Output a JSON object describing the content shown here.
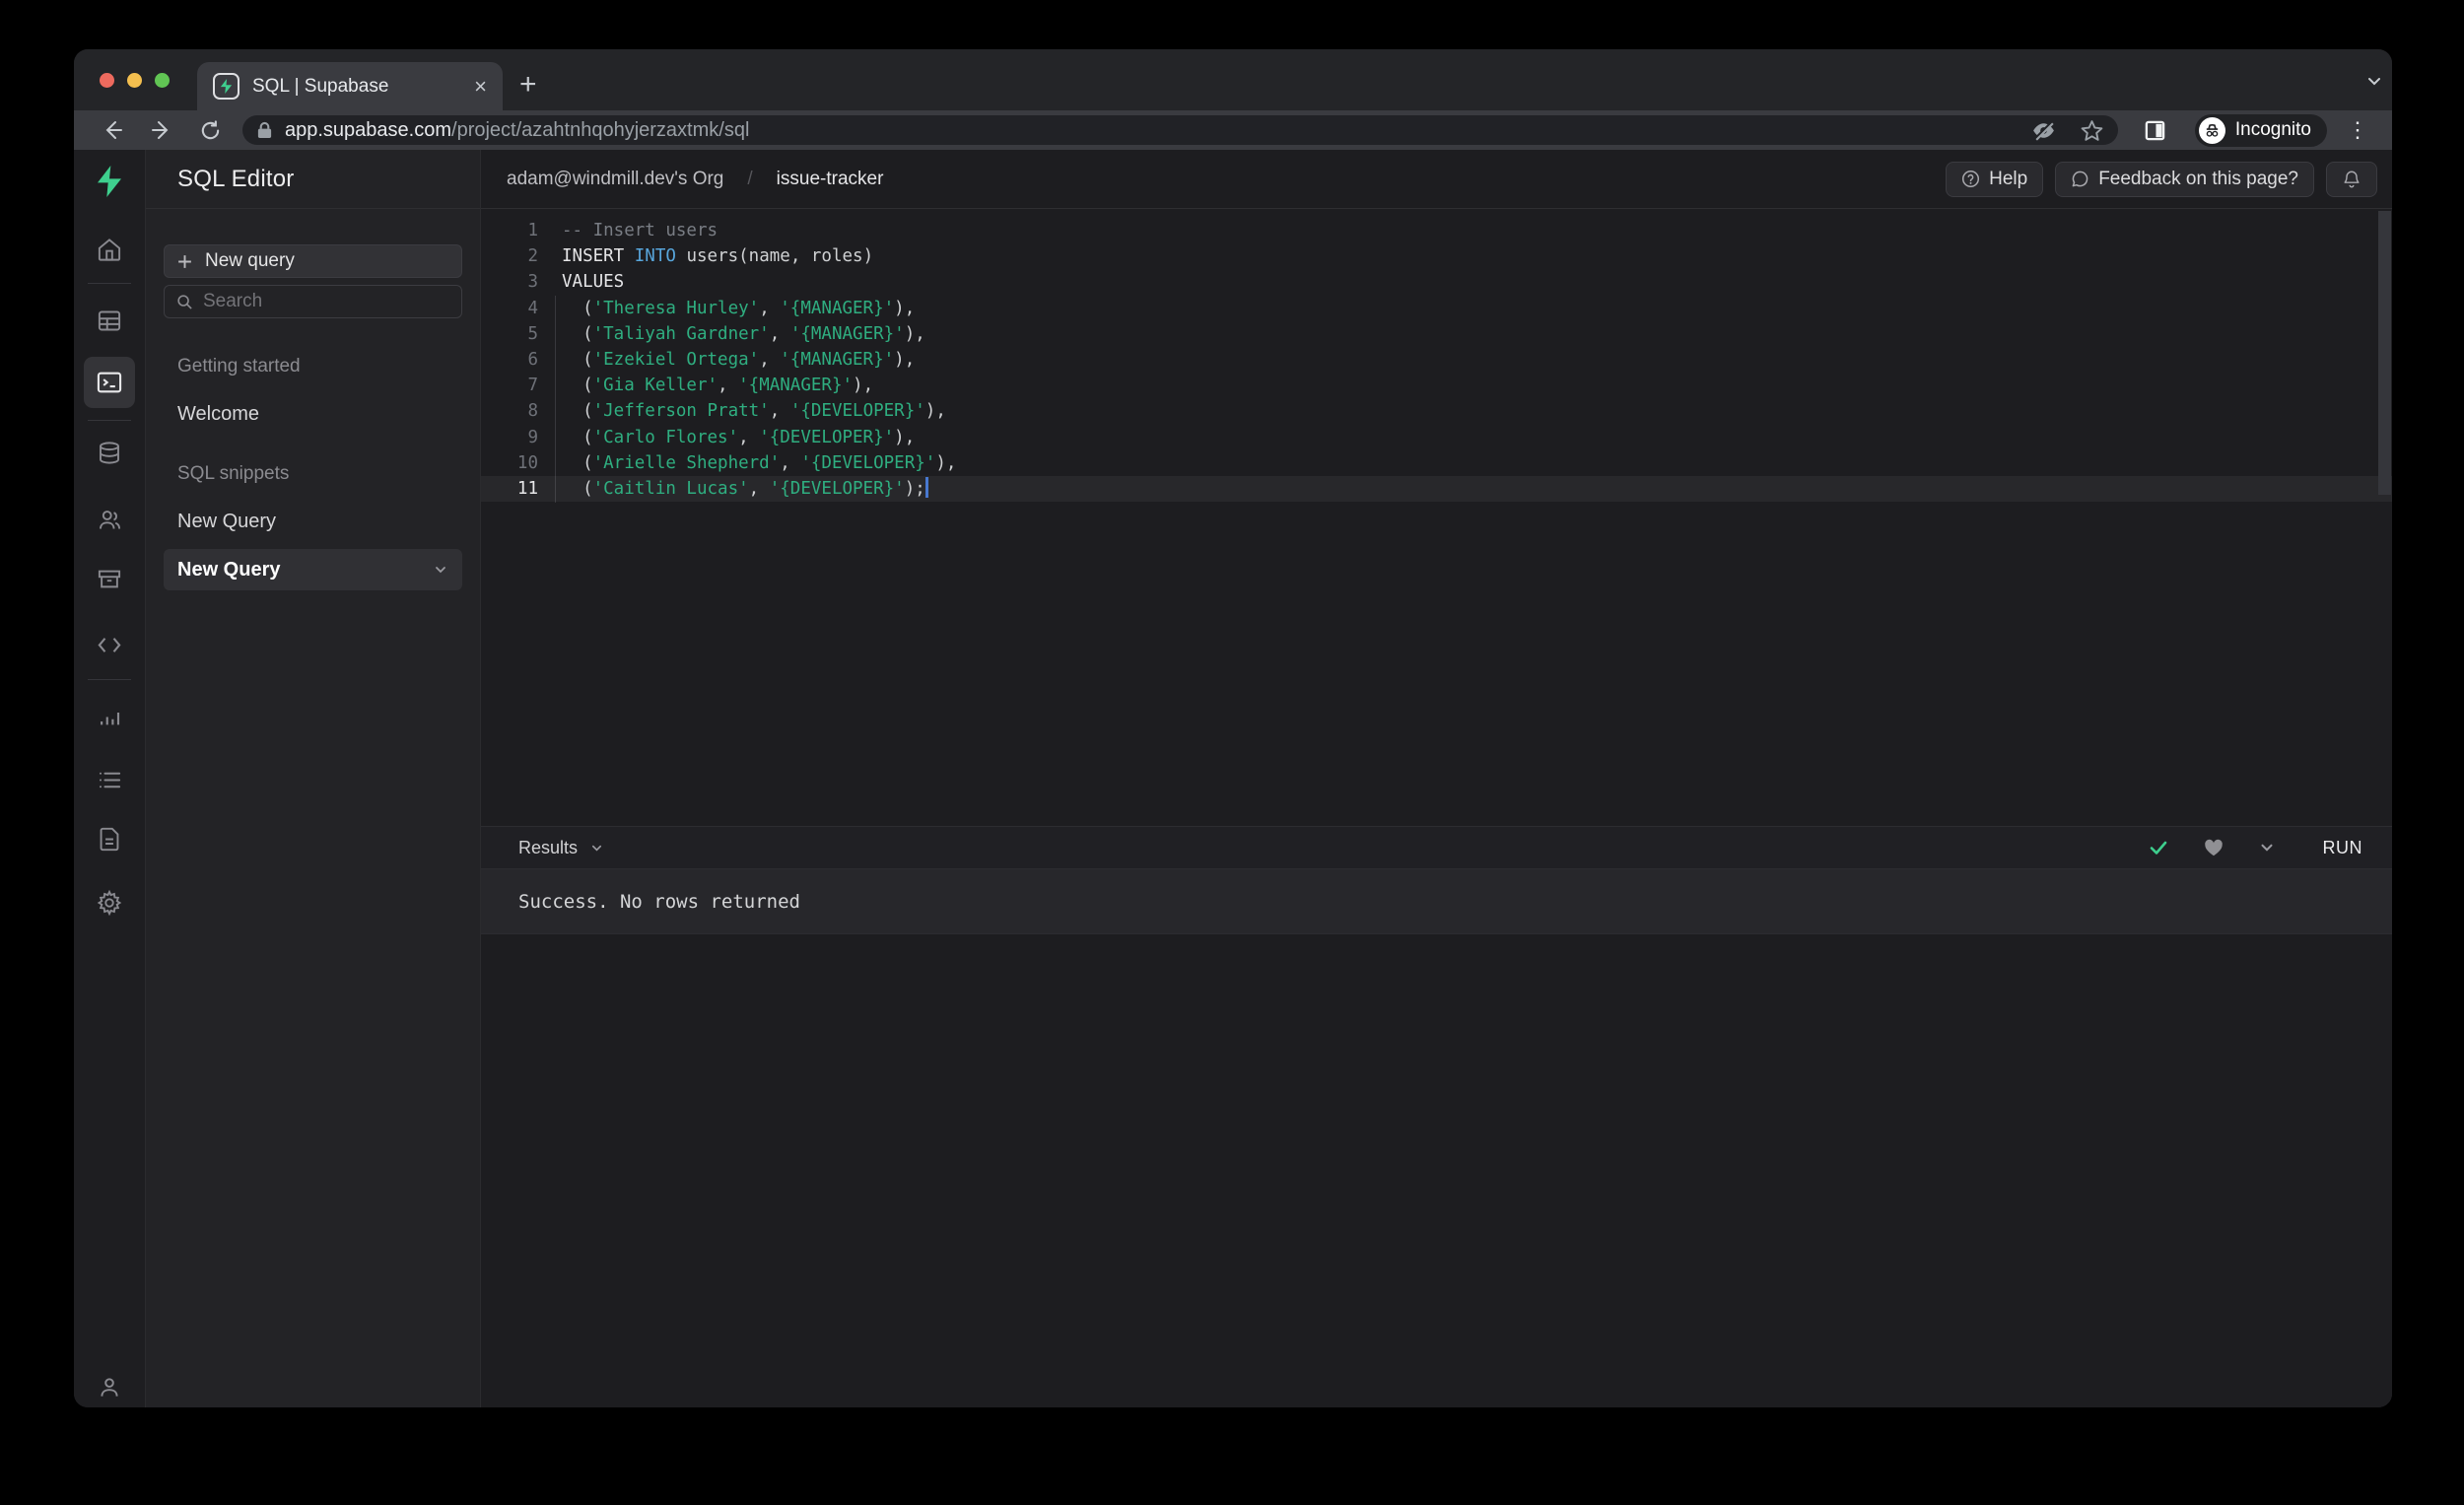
{
  "browser": {
    "tab_title": "SQL | Supabase",
    "url_host": "app.supabase.com",
    "url_path": "/project/azahtnhqohyjerzaxtmk/sql",
    "incognito_label": "Incognito"
  },
  "sidebar": {
    "title": "SQL Editor",
    "new_query_button": "New query",
    "search_placeholder": "Search",
    "section_getting_started": "Getting started",
    "item_welcome": "Welcome",
    "section_sql_snippets": "SQL snippets",
    "item_new_query": "New Query",
    "item_new_query_selected": "New Query"
  },
  "header": {
    "breadcrumb_org": "adam@windmill.dev's Org",
    "breadcrumb_separator": "/",
    "breadcrumb_project": "issue-tracker",
    "help_button": "Help",
    "feedback_button": "Feedback on this page?"
  },
  "editor": {
    "lines": [
      {
        "n": "1",
        "tokens": [
          {
            "t": "-- Insert users",
            "c": "com"
          }
        ]
      },
      {
        "n": "2",
        "tokens": [
          {
            "t": "INSERT ",
            "c": "kw"
          },
          {
            "t": "INTO",
            "c": "kw2"
          },
          {
            "t": " users(name, roles)",
            "c": "pln"
          }
        ]
      },
      {
        "n": "3",
        "tokens": [
          {
            "t": "VALUES",
            "c": "kw"
          }
        ]
      },
      {
        "n": "4",
        "tokens": [
          {
            "t": "  (",
            "c": "pln"
          },
          {
            "t": "'Theresa Hurley'",
            "c": "str"
          },
          {
            "t": ", ",
            "c": "pln"
          },
          {
            "t": "'{MANAGER}'",
            "c": "str"
          },
          {
            "t": "),",
            "c": "pln"
          }
        ]
      },
      {
        "n": "5",
        "tokens": [
          {
            "t": "  (",
            "c": "pln"
          },
          {
            "t": "'Taliyah Gardner'",
            "c": "str"
          },
          {
            "t": ", ",
            "c": "pln"
          },
          {
            "t": "'{MANAGER}'",
            "c": "str"
          },
          {
            "t": "),",
            "c": "pln"
          }
        ]
      },
      {
        "n": "6",
        "tokens": [
          {
            "t": "  (",
            "c": "pln"
          },
          {
            "t": "'Ezekiel Ortega'",
            "c": "str"
          },
          {
            "t": ", ",
            "c": "pln"
          },
          {
            "t": "'{MANAGER}'",
            "c": "str"
          },
          {
            "t": "),",
            "c": "pln"
          }
        ]
      },
      {
        "n": "7",
        "tokens": [
          {
            "t": "  (",
            "c": "pln"
          },
          {
            "t": "'Gia Keller'",
            "c": "str"
          },
          {
            "t": ", ",
            "c": "pln"
          },
          {
            "t": "'{MANAGER}'",
            "c": "str"
          },
          {
            "t": "),",
            "c": "pln"
          }
        ]
      },
      {
        "n": "8",
        "tokens": [
          {
            "t": "  (",
            "c": "pln"
          },
          {
            "t": "'Jefferson Pratt'",
            "c": "str"
          },
          {
            "t": ", ",
            "c": "pln"
          },
          {
            "t": "'{DEVELOPER}'",
            "c": "str"
          },
          {
            "t": "),",
            "c": "pln"
          }
        ]
      },
      {
        "n": "9",
        "tokens": [
          {
            "t": "  (",
            "c": "pln"
          },
          {
            "t": "'Carlo Flores'",
            "c": "str"
          },
          {
            "t": ", ",
            "c": "pln"
          },
          {
            "t": "'{DEVELOPER}'",
            "c": "str"
          },
          {
            "t": "),",
            "c": "pln"
          }
        ]
      },
      {
        "n": "10",
        "tokens": [
          {
            "t": "  (",
            "c": "pln"
          },
          {
            "t": "'Arielle Shepherd'",
            "c": "str"
          },
          {
            "t": ", ",
            "c": "pln"
          },
          {
            "t": "'{DEVELOPER}'",
            "c": "str"
          },
          {
            "t": "),",
            "c": "pln"
          }
        ]
      },
      {
        "n": "11",
        "cursor": true,
        "tokens": [
          {
            "t": "  (",
            "c": "pln"
          },
          {
            "t": "'Caitlin Lucas'",
            "c": "str"
          },
          {
            "t": ", ",
            "c": "pln"
          },
          {
            "t": "'{DEVELOPER}'",
            "c": "str"
          },
          {
            "t": ");",
            "c": "pln"
          }
        ]
      }
    ]
  },
  "results": {
    "label": "Results",
    "run_button": "RUN",
    "message": "Success. No rows returned"
  },
  "colors": {
    "accent_green": "#3ecf8e",
    "string_green": "#2fae80",
    "keyword_blue": "#58a6dc",
    "caret_blue": "#4878d0"
  }
}
